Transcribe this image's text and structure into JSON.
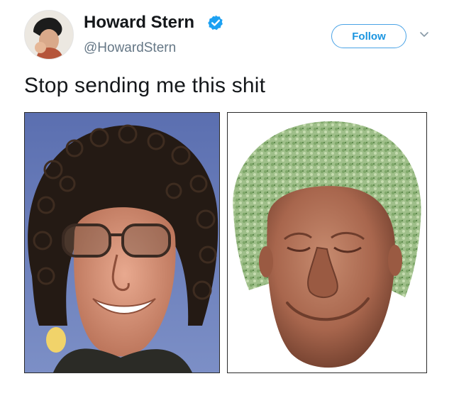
{
  "tweet": {
    "author": {
      "display_name": "Howard Stern",
      "handle": "@HowardStern",
      "verified": true,
      "verified_icon": "verified-badge-icon"
    },
    "follow_label": "Follow",
    "more_icon": "chevron-down-icon",
    "text": "Stop sending me this shit",
    "media": [
      {
        "name": "photo-howard-stern-portrait"
      },
      {
        "name": "photo-chia-pet-head"
      }
    ]
  },
  "colors": {
    "text": "#14171a",
    "secondary": "#657786",
    "accent": "#1da1f2"
  }
}
